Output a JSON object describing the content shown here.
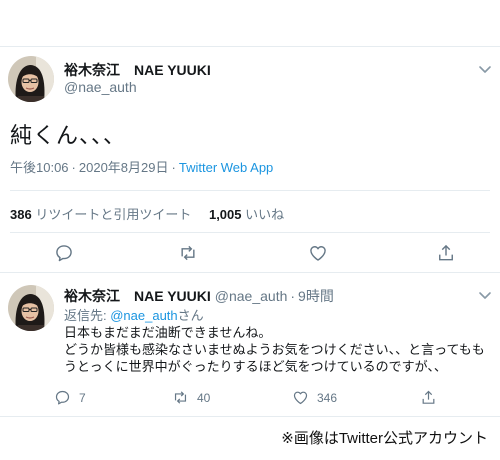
{
  "main_tweet": {
    "display_name": "裕木奈江　NAE YUUKI",
    "handle": "@nae_auth",
    "text": "純くん、、、",
    "time": "午後10:06",
    "date": "2020年8月29日",
    "source": "Twitter Web App",
    "meta_sep": "·",
    "retweet_count": "386",
    "retweet_label": "リツイートと引用ツイート",
    "like_count": "1,005",
    "like_label": "いいね"
  },
  "reply_tweet": {
    "display_name": "裕木奈江　NAE YUUKI",
    "handle": "@nae_auth",
    "time_ago": "9時間",
    "meta_sep": "·",
    "reply_prefix": "返信先: ",
    "reply_mention": "@nae_auth",
    "reply_suffix": "さん",
    "lines": [
      "日本もまだまだ油断できませんね。",
      "どうか皆様も感染なさいませぬようお気をつけください、、と言ってもも",
      "うとっくに世界中がぐったりするほど気をつけているのですが、、"
    ],
    "reply_count": "7",
    "retweet_count": "40",
    "like_count": "346"
  },
  "caption": "※画像はTwitter公式アカウント",
  "colors": {
    "link": "#1b95e0",
    "muted": "#657786",
    "text": "#14171a",
    "border": "#e6ecf0"
  },
  "icons": [
    "chevron-down-icon",
    "reply-icon",
    "retweet-icon",
    "like-icon",
    "share-icon"
  ]
}
